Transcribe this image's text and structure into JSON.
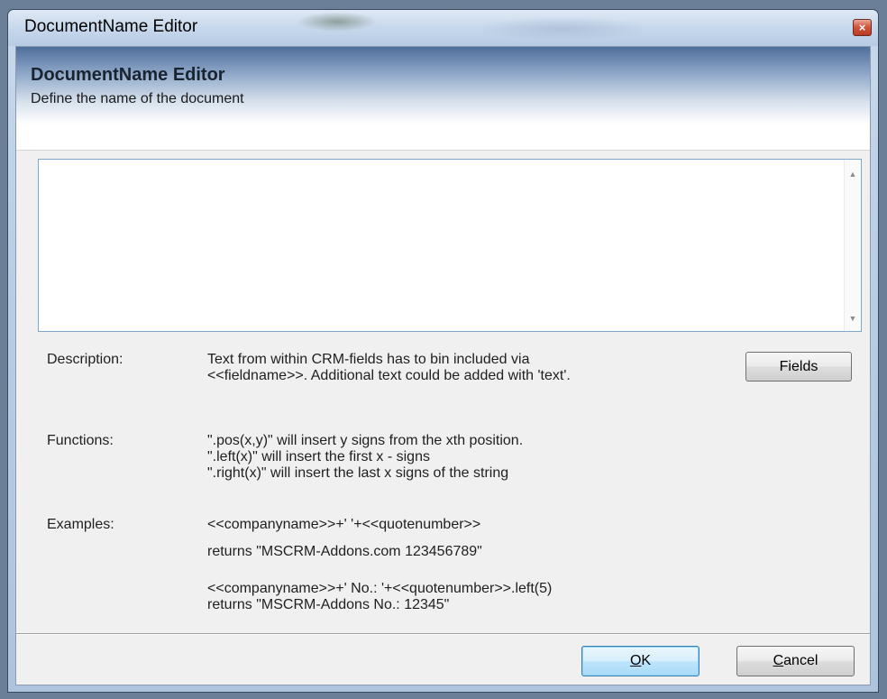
{
  "window": {
    "title": "DocumentName Editor",
    "close_glyph": "×"
  },
  "header": {
    "title": "DocumentName Editor",
    "subtitle": "Define the name of the document"
  },
  "editor": {
    "value": "",
    "scroll_up_glyph": "▲",
    "scroll_down_glyph": "▼"
  },
  "description": {
    "label": "Description:",
    "line1": "Text from within CRM-fields has to bin included via",
    "line2": "<<fieldname>>. Additional text could be added with 'text'."
  },
  "fields_button": {
    "label": "Fields"
  },
  "functions": {
    "label": "Functions:",
    "line1": "\".pos(x,y)\" will insert y signs from the xth position.",
    "line2": "\".left(x)\" will insert the first x - signs",
    "line3": "\".right(x)\" will insert the last x signs of the string"
  },
  "examples": {
    "label": "Examples:",
    "ex1_code": "<<companyname>>+' '+<<quotenumber>>",
    "ex1_result": "returns \"MSCRM-Addons.com 123456789\"",
    "ex2_code": "<<companyname>>+' No.: '+<<quotenumber>>.left(5)",
    "ex2_result": "returns \"MSCRM-Addons No.: 12345\""
  },
  "footer": {
    "ok_mnemonic": "O",
    "ok_rest": "K",
    "cancel_mnemonic": "C",
    "cancel_rest": "ancel"
  }
}
